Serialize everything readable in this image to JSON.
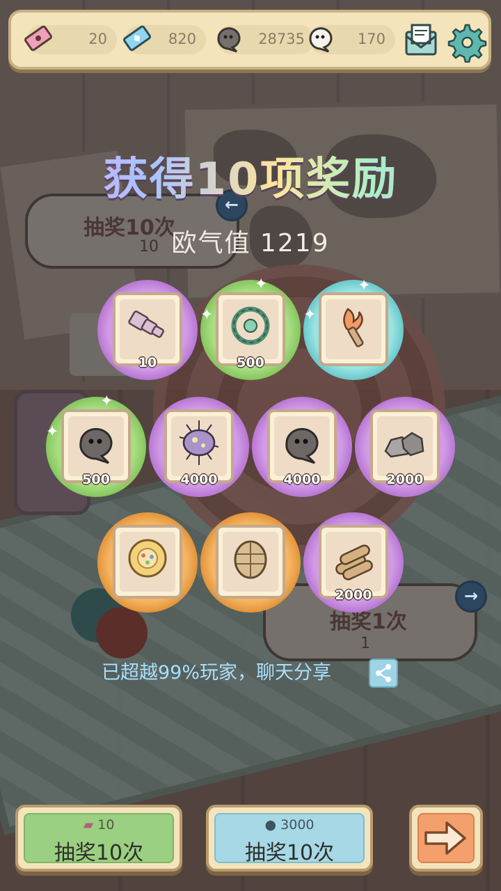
{
  "topbar": {
    "resources": [
      {
        "name": "ticket",
        "value": "20"
      },
      {
        "name": "crystal",
        "value": "820"
      },
      {
        "name": "dark-soul",
        "value": "28735"
      },
      {
        "name": "white-soul",
        "value": "170"
      }
    ]
  },
  "background": {
    "left_bubble": {
      "label": "抽奖10次",
      "cost": "10"
    },
    "right_bubble": {
      "label": "抽奖1次",
      "cost": "1"
    }
  },
  "title": "获得10项奖励",
  "luck_text": "欧气值 1219",
  "rewards": [
    {
      "item": "purple-telescope",
      "quantity": "10",
      "rarity": "purple"
    },
    {
      "item": "green-vine-wreath",
      "quantity": "500",
      "rarity": "green"
    },
    {
      "item": "flame-torch",
      "quantity": "",
      "rarity": "cyan"
    },
    {
      "item": "dark-soul",
      "quantity": "500",
      "rarity": "green"
    },
    {
      "item": "purple-bacterium",
      "quantity": "4000",
      "rarity": "purple"
    },
    {
      "item": "dark-soul",
      "quantity": "4000",
      "rarity": "purple"
    },
    {
      "item": "stones",
      "quantity": "2000",
      "rarity": "purple"
    },
    {
      "item": "golden-disc",
      "quantity": "",
      "rarity": "orange"
    },
    {
      "item": "fossil-shell",
      "quantity": "",
      "rarity": "orange"
    },
    {
      "item": "logs",
      "quantity": "2000",
      "rarity": "purple"
    }
  ],
  "share_text": "已超越99%玩家，聊天分享",
  "buttons": {
    "draw_ticket": {
      "cost": "10",
      "label": "抽奖10次"
    },
    "draw_soul": {
      "cost": "3000",
      "label": "抽奖10次"
    },
    "next": {
      "icon": "right-arrow-icon"
    }
  },
  "colors": {
    "purple": "#c88ce0",
    "green": "#9ad473",
    "cyan": "#8ad9da",
    "orange": "#eea550",
    "share_text": "#a9e0ff",
    "panel": "#f3e4bb"
  }
}
